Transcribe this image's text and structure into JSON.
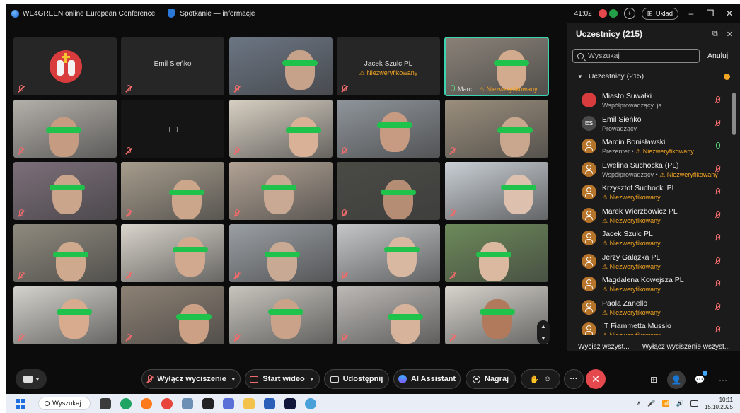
{
  "window": {
    "app_title": "WE4GREEN online European Conference",
    "meeting_title": "Spotkanie — informacje",
    "timer": "41:02",
    "layout_label": "Układ",
    "min": "–",
    "max": "❐",
    "close": "✕"
  },
  "tiles": [
    {
      "type": "crest"
    },
    {
      "type": "name",
      "name": "Emil Sieńko"
    },
    {
      "type": "video",
      "bg": "#6b7583",
      "face": "#c7a28a"
    },
    {
      "type": "name",
      "name": "Jacek Szulc PL",
      "status": "Niezweryfikowany"
    },
    {
      "type": "video",
      "bg": "#8a8278",
      "face": "#d2ab8f",
      "active": true,
      "label_name": "Marc...",
      "label_status": "Niezweryfikowany"
    },
    {
      "type": "video",
      "bg": "#b4b0aa",
      "face": "#c59b82"
    },
    {
      "type": "camoff"
    },
    {
      "type": "video",
      "bg": "#d7cfc2",
      "face": "#d8b197"
    },
    {
      "type": "video",
      "bg": "#8f959b",
      "face": "#c79a82"
    },
    {
      "type": "video",
      "bg": "#9b8f7d",
      "face": "#c9a78e"
    },
    {
      "type": "video",
      "bg": "#7c6f7a",
      "face": "#caa58c"
    },
    {
      "type": "video",
      "bg": "#a69c8c",
      "face": "#cba68b"
    },
    {
      "type": "video",
      "bg": "#b1a294",
      "face": "#c9a894"
    },
    {
      "type": "video",
      "bg": "#4a4a45",
      "face": "#b58d74"
    },
    {
      "type": "video",
      "bg": "#c9cfd5",
      "face": "#ddc0ad"
    },
    {
      "type": "video",
      "bg": "#8f8a7e",
      "face": "#cfa98e"
    },
    {
      "type": "video",
      "bg": "#d9d4cb",
      "face": "#d1a98e"
    },
    {
      "type": "video",
      "bg": "#9a9fa4",
      "face": "#c8a994"
    },
    {
      "type": "video",
      "bg": "#c4c6c8",
      "face": "#d9b8a1"
    },
    {
      "type": "video",
      "bg": "#6d8a5a",
      "face": "#dbb9a0"
    },
    {
      "type": "video",
      "bg": "#d4d2cc",
      "face": "#d8ab8e"
    },
    {
      "type": "video",
      "bg": "#8d8174",
      "face": "#cba085"
    },
    {
      "type": "video",
      "bg": "#c7c4bd",
      "face": "#caa28a"
    },
    {
      "type": "video",
      "bg": "#bcb9b5",
      "face": "#d7b39b"
    },
    {
      "type": "video",
      "bg": "#d6d3cc",
      "face": "#b27a5d"
    }
  ],
  "panel": {
    "title": "Uczestnicy (215)",
    "popout": "⧉",
    "close": "✕",
    "search_placeholder": "Wyszukaj",
    "cancel_label": "Anuluj",
    "group_label": "Uczestnicy (215)",
    "participants": [
      {
        "name": "Miasto Suwałki",
        "role": "Współprowadzący, ja",
        "status": "",
        "avatar": "img",
        "mic": "off"
      },
      {
        "name": "Emil Sieńko",
        "role": "Prowadzący",
        "status": "",
        "avatar": "init",
        "initials": "ES",
        "mic": "off"
      },
      {
        "name": "Marcin Bonisławski",
        "role": "Prezenter • ",
        "status": "Niezweryfikowany",
        "avatar": "gen",
        "mic": "on"
      },
      {
        "name": "Ewelina Suchocka (PL)",
        "role": "Współprowadzący • ",
        "status": "Niezweryfikowany",
        "avatar": "gen",
        "mic": "off"
      },
      {
        "name": "Krzysztof Suchocki PL",
        "role": "",
        "status": "Niezweryfikowany",
        "avatar": "gen",
        "mic": "off"
      },
      {
        "name": "Marek Wierzbowicz PL",
        "role": "",
        "status": "Niezweryfikowany",
        "avatar": "gen",
        "mic": "off"
      },
      {
        "name": "Jacek Szulc PL",
        "role": "",
        "status": "Niezweryfikowany",
        "avatar": "gen",
        "mic": "off"
      },
      {
        "name": "Jerzy Gałązka PL",
        "role": "",
        "status": "Niezweryfikowany",
        "avatar": "gen",
        "mic": "off"
      },
      {
        "name": "Magdalena Kowejsza PL",
        "role": "",
        "status": "Niezweryfikowany",
        "avatar": "gen",
        "mic": "off"
      },
      {
        "name": "Paola Zanello",
        "role": "",
        "status": "Niezweryfikowany",
        "avatar": "gen",
        "mic": "off"
      },
      {
        "name": "IT Fiammetta Mussio",
        "role": "",
        "status": "Niezweryfikowany",
        "avatar": "gen",
        "mic": "off"
      }
    ],
    "mute_all": "Wycisz wszyst...",
    "unmute_all": "Wyłącz wyciszenie wszyst...",
    "more": "···"
  },
  "controls": {
    "unmute": "Wyłącz wyciszenie",
    "start_video": "Start wideo",
    "share": "Udostępnij",
    "ai_assistant": "AI Assistant",
    "record": "Nagraj",
    "more": "···",
    "leave": "✕"
  },
  "taskbar": {
    "search": "Wyszukaj",
    "time": "10:11",
    "date": "15.10.2025"
  }
}
